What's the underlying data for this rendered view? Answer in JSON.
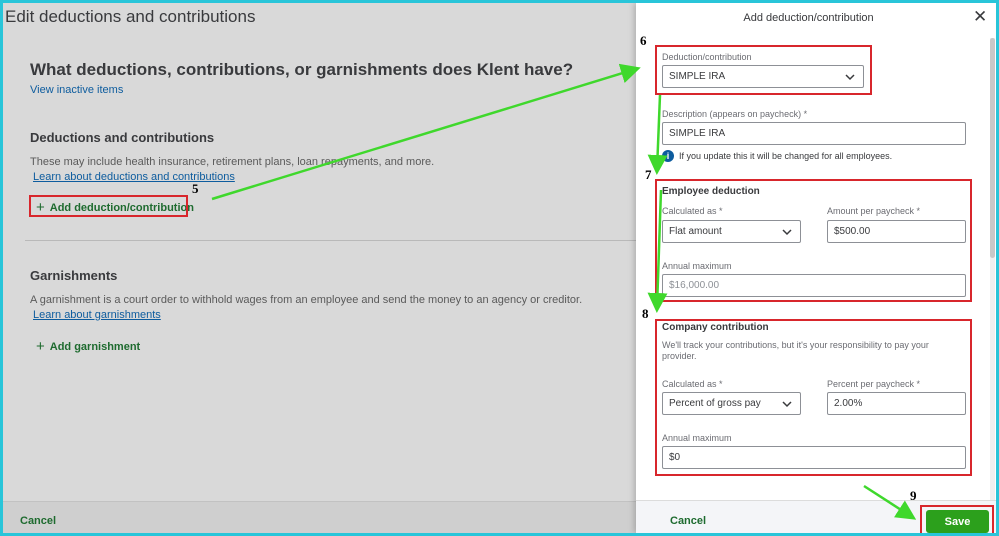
{
  "left": {
    "title": "Edit deductions and contributions",
    "question": "What deductions, contributions, or garnishments does Klent have?",
    "inactive_link": "View inactive items",
    "deductions": {
      "heading": "Deductions and contributions",
      "text": "These may include health insurance, retirement plans, loan repayments, and more.",
      "link": "Learn about deductions and contributions",
      "add_button": "Add deduction/contribution"
    },
    "garnishments": {
      "heading": "Garnishments",
      "text": "A garnishment is a court order to withhold wages from an employee and send the money to an agency or creditor.",
      "link": "Learn about garnishments",
      "add_button": "Add garnishment"
    },
    "footer": {
      "cancel": "Cancel"
    }
  },
  "drawer": {
    "title": "Add deduction/contribution",
    "close_icon": "close-icon",
    "type": {
      "label": "Deduction/contribution",
      "value": "SIMPLE IRA"
    },
    "description": {
      "label": "Description (appears on paycheck) *",
      "value": "SIMPLE IRA"
    },
    "info": "If you update this it will be changed for all employees.",
    "employee": {
      "heading": "Employee deduction",
      "calc_label": "Calculated as *",
      "calc_value": "Flat amount",
      "amount_label": "Amount per paycheck *",
      "amount_value": "$500.00",
      "annual_label": "Annual maximum",
      "annual_value": "$16,000.00"
    },
    "company": {
      "heading": "Company contribution",
      "text": "We'll track your contributions, but it's your responsibility to pay your provider.",
      "calc_label": "Calculated as *",
      "calc_value": "Percent of gross pay",
      "percent_label": "Percent per paycheck *",
      "percent_value": "2.00%",
      "annual_label": "Annual maximum",
      "annual_value": "$0"
    },
    "footer": {
      "cancel": "Cancel",
      "save": "Save"
    }
  },
  "annotations": {
    "step5": "5",
    "step6": "6",
    "step7": "7",
    "step8": "8",
    "step9": "9",
    "box_color": "#d8262c",
    "arrow_color": "#3fd82c"
  }
}
